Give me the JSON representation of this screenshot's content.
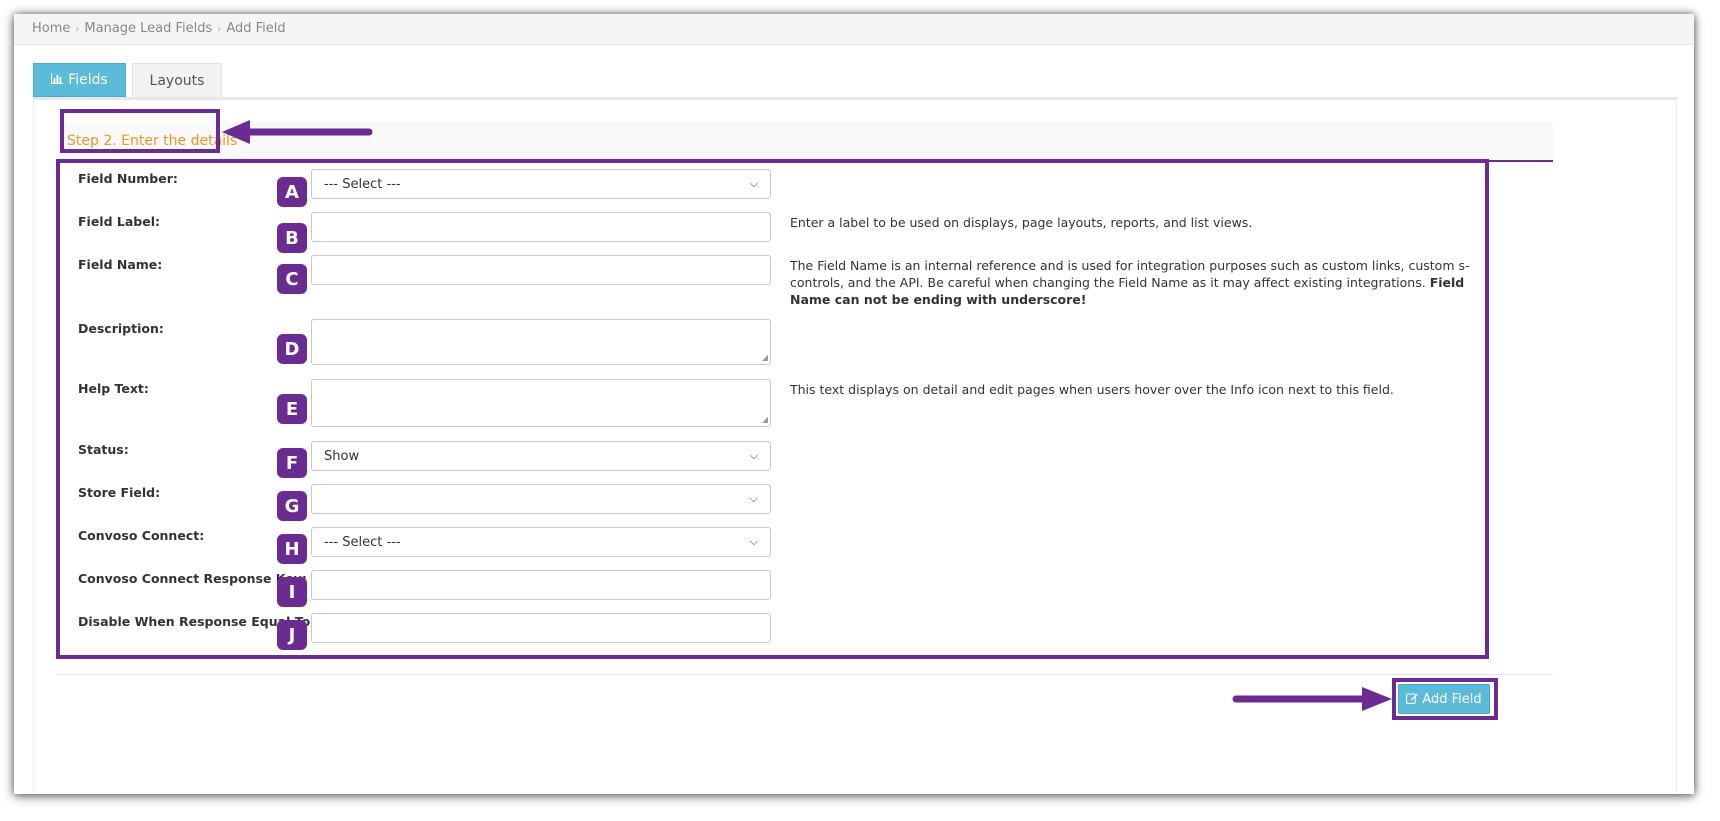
{
  "breadcrumb": {
    "items": [
      "Home",
      "Manage Lead Fields",
      "Add Field"
    ]
  },
  "tabs": {
    "fields": "Fields",
    "layouts": "Layouts"
  },
  "step": {
    "title": "Step 2. Enter the details"
  },
  "form": {
    "field_number": {
      "label": "Field Number:",
      "badge": "A",
      "value": "--- Select ---"
    },
    "field_label": {
      "label": "Field Label:",
      "badge": "B",
      "value": "",
      "help": "Enter a label to be used on displays, page layouts, reports, and list views."
    },
    "field_name": {
      "label": "Field Name:",
      "badge": "C",
      "value": "",
      "help": "The Field Name is an internal reference and is used for integration purposes such as custom links, custom s-controls, and the API. Be careful when changing the Field Name as it may affect existing integrations. ",
      "help_bold": "Field Name can not be ending with underscore!"
    },
    "description": {
      "label": "Description:",
      "badge": "D",
      "value": ""
    },
    "help_text": {
      "label": "Help Text:",
      "badge": "E",
      "value": "",
      "help": "This text displays on detail and edit pages when users hover over the Info icon next to this field."
    },
    "status": {
      "label": "Status:",
      "badge": "F",
      "value": "Show"
    },
    "store_field": {
      "label": "Store Field:",
      "badge": "G",
      "value": ""
    },
    "convoso_connect": {
      "label": "Convoso Connect:",
      "badge": "H",
      "value": "--- Select ---"
    },
    "response_key": {
      "label": "Convoso Connect Response Key:",
      "badge": "I",
      "value": ""
    },
    "disable_when": {
      "label": "Disable When Response Equal To:",
      "badge": "J",
      "value": ""
    }
  },
  "actions": {
    "add_field": "Add Field"
  },
  "colors": {
    "accent": "#6a2c91",
    "tab_active": "#5bbbd8",
    "step_title": "#f0932b"
  },
  "icons": {
    "tab_fields": "bar-chart-icon",
    "add_field": "edit-icon",
    "breadcrumb_sep": "chevron-right-icon",
    "select": "chevron-down-icon"
  }
}
